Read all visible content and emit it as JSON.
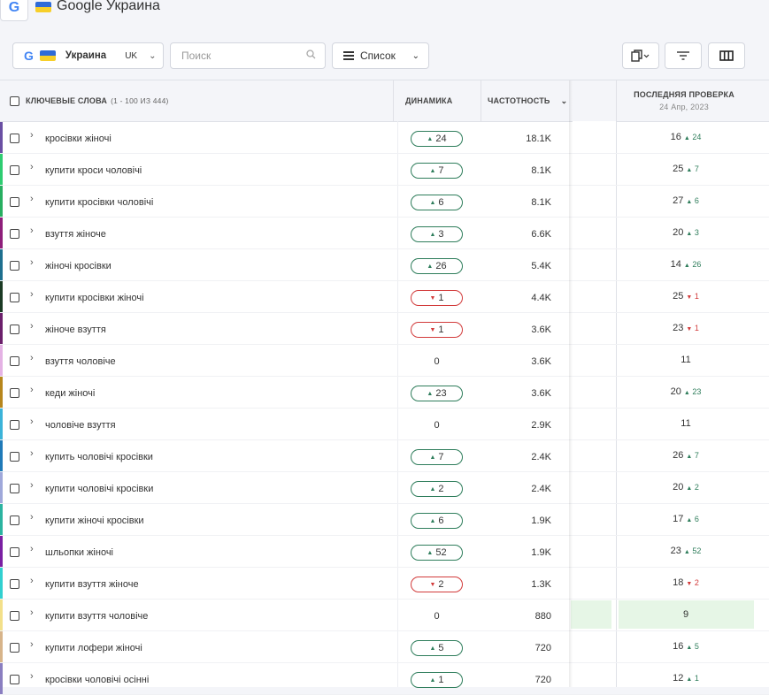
{
  "header": {
    "title": "Google Украина",
    "g_logo": "G"
  },
  "toolbar": {
    "location": {
      "g": "G",
      "country": "Украина",
      "lang": "UK"
    },
    "search": {
      "placeholder": "Поиск",
      "value": ""
    },
    "view": {
      "label": "Список"
    }
  },
  "table": {
    "headers": {
      "keywords": "Ключевые слова",
      "keywords_count": "(1 - 100 из 444)",
      "dynamics": "Динамика",
      "frequency": "Частотность",
      "last_check": "Последняя проверка",
      "last_check_date": "24 Апр, 2023"
    },
    "rows": [
      {
        "kw": "кросівки жіночі",
        "dyn": "24",
        "dir": "up",
        "freq": "18.1K",
        "pos": "16",
        "chg": "24",
        "stripe": "#6a4fa3"
      },
      {
        "kw": "купити кроси чоловічі",
        "dyn": "7",
        "dir": "up",
        "freq": "8.1K",
        "pos": "25",
        "chg": "7",
        "stripe": "#2ecc71"
      },
      {
        "kw": "купити кросівки чоловічі",
        "dyn": "6",
        "dir": "up",
        "freq": "8.1K",
        "pos": "27",
        "chg": "6",
        "stripe": "#27ae60"
      },
      {
        "kw": "взуття жіноче",
        "dyn": "3",
        "dir": "up",
        "freq": "6.6K",
        "pos": "20",
        "chg": "3",
        "stripe": "#8e1e7a"
      },
      {
        "kw": "жіночі кросівки",
        "dyn": "26",
        "dir": "up",
        "freq": "5.4K",
        "pos": "14",
        "chg": "26",
        "stripe": "#1e6f8e"
      },
      {
        "kw": "купити кросівки жіночі",
        "dyn": "1",
        "dir": "down",
        "freq": "4.4K",
        "pos": "25",
        "chg": "1",
        "stripe": "#1b3a24"
      },
      {
        "kw": "жіноче взуття",
        "dyn": "1",
        "dir": "down",
        "freq": "3.6K",
        "pos": "23",
        "chg": "1",
        "stripe": "#6b1f6b"
      },
      {
        "kw": "взуття чоловіче",
        "dyn": "0",
        "dir": "none",
        "freq": "3.6K",
        "pos": "11",
        "chg": "",
        "stripe": "#e4b2e4"
      },
      {
        "kw": "кеди жіночі",
        "dyn": "23",
        "dir": "up",
        "freq": "3.6K",
        "pos": "20",
        "chg": "23",
        "stripe": "#b7861c"
      },
      {
        "kw": "чоловіче взуття",
        "dyn": "0",
        "dir": "none",
        "freq": "2.9K",
        "pos": "11",
        "chg": "",
        "stripe": "#3bb3d9"
      },
      {
        "kw": "купить чоловічі кросівки",
        "dyn": "7",
        "dir": "up",
        "freq": "2.4K",
        "pos": "26",
        "chg": "7",
        "stripe": "#1f7ab8"
      },
      {
        "kw": "купити чоловічі кросівки",
        "dyn": "2",
        "dir": "up",
        "freq": "2.4K",
        "pos": "20",
        "chg": "2",
        "stripe": "#9fa8da"
      },
      {
        "kw": "купити жіночі кросівки",
        "dyn": "6",
        "dir": "up",
        "freq": "1.9K",
        "pos": "17",
        "chg": "6",
        "stripe": "#2bb3a0"
      },
      {
        "kw": "шльопки жіночі",
        "dyn": "52",
        "dir": "up",
        "freq": "1.9K",
        "pos": "23",
        "chg": "52",
        "stripe": "#7a1fa2"
      },
      {
        "kw": "купити взуття жіноче",
        "dyn": "2",
        "dir": "down",
        "freq": "1.3K",
        "pos": "18",
        "chg": "2",
        "stripe": "#31d0d0"
      },
      {
        "kw": "купити взуття чоловіче",
        "dyn": "0",
        "dir": "none",
        "freq": "880",
        "pos": "9",
        "chg": "",
        "stripe": "#f3e08a",
        "hl": true
      },
      {
        "kw": "купити лофери жіночі",
        "dyn": "5",
        "dir": "up",
        "freq": "720",
        "pos": "16",
        "chg": "5",
        "stripe": "#d7b48a"
      },
      {
        "kw": "кросівки чоловічі осінні",
        "dyn": "1",
        "dir": "up",
        "freq": "720",
        "pos": "12",
        "chg": "1",
        "stripe": "#8a7ec0"
      }
    ]
  }
}
